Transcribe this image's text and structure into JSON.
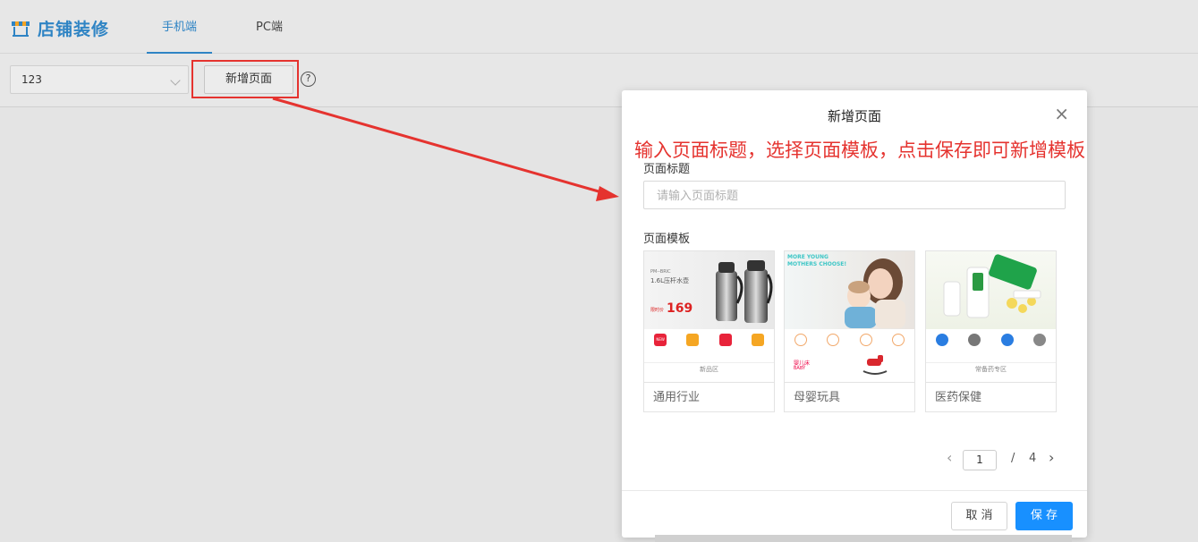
{
  "app": {
    "title": "店铺装修"
  },
  "tabs": [
    {
      "label": "手机端",
      "active": true
    },
    {
      "label": "PC端",
      "active": false
    }
  ],
  "toolbar": {
    "select_value": "123",
    "add_page_label": "新增页面",
    "help_glyph": "?"
  },
  "annotation": "输入页面标题，选择页面模板，点击保存即可新增模板",
  "modal": {
    "title": "新增页面",
    "close_glyph": "×",
    "page_title_label": "页面标题",
    "page_title_placeholder": "请输入页面标题",
    "template_label": "页面模板",
    "templates": [
      {
        "name": "通用行业",
        "hero_text_1": "PM--BRIC",
        "hero_text_2": "1.6L压杆水壶",
        "price_prefix": "限时价",
        "price": "169",
        "badge": "NEW",
        "section": "新品区"
      },
      {
        "name": "母婴玩具",
        "hero_text_1": "MORE YOUNG",
        "hero_text_2": "MOTHERS CHOOSE!",
        "section_text": "婴儿床",
        "section_sub": "BABY"
      },
      {
        "name": "医药保健",
        "section": "常备药专区"
      }
    ],
    "pagination": {
      "current": "1",
      "separator": "/",
      "total": "4",
      "prev_glyph": "‹",
      "next_glyph": "›"
    },
    "cancel_label": "取 消",
    "save_label": "保 存"
  },
  "colors": {
    "accent": "#2f84c4",
    "primary_button": "#1890ff",
    "highlight": "#e5332f"
  }
}
